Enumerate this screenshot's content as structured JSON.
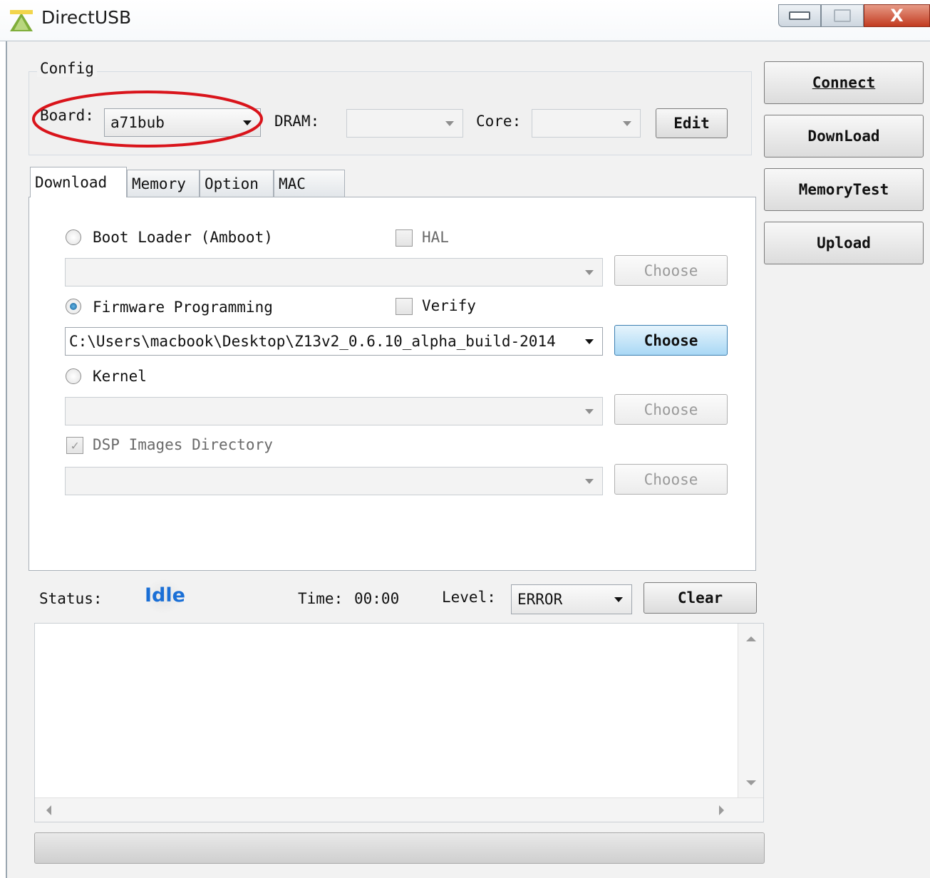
{
  "window": {
    "title": "DirectUSB",
    "controls": {
      "minimize": "▭",
      "maximize": "□",
      "close": "X"
    }
  },
  "config": {
    "group_label": "Config",
    "board_label": "Board:",
    "board_value": "a71bub",
    "dram_label": "DRAM:",
    "dram_value": "",
    "core_label": "Core:",
    "core_value": "",
    "edit_button": "Edit"
  },
  "side_buttons": {
    "connect": "Connect",
    "download": "DownLoad",
    "memorytest": "MemoryTest",
    "upload": "Upload"
  },
  "tabs": [
    {
      "label": "Download",
      "active": true
    },
    {
      "label": "Memory",
      "active": false
    },
    {
      "label": "Option",
      "active": false
    },
    {
      "label": "MAC",
      "active": false
    }
  ],
  "download_tab": {
    "bootloader_label": "Boot Loader (Amboot)",
    "hal_label": "HAL",
    "bootloader_path": "",
    "firmware_label": "Firmware Programming",
    "verify_label": "Verify",
    "firmware_path": "C:\\Users\\macbook\\Desktop\\Z13v2_0.6.10_alpha_build-2014",
    "kernel_label": "Kernel",
    "kernel_path": "",
    "dsp_label": "DSP Images Directory",
    "dsp_path": "",
    "choose_label": "Choose"
  },
  "status": {
    "status_label": "Status:",
    "status_value": "Idle",
    "time_label": "Time:",
    "time_value": "00:00",
    "level_label": "Level:",
    "level_value": "ERROR",
    "clear_button": "Clear"
  },
  "log": {
    "text": ""
  },
  "progress": {
    "value": 0
  },
  "colors": {
    "annotation_ellipse": "#d9141b",
    "status_idle": "#1a6fd6",
    "close_button": "#c9452a"
  }
}
